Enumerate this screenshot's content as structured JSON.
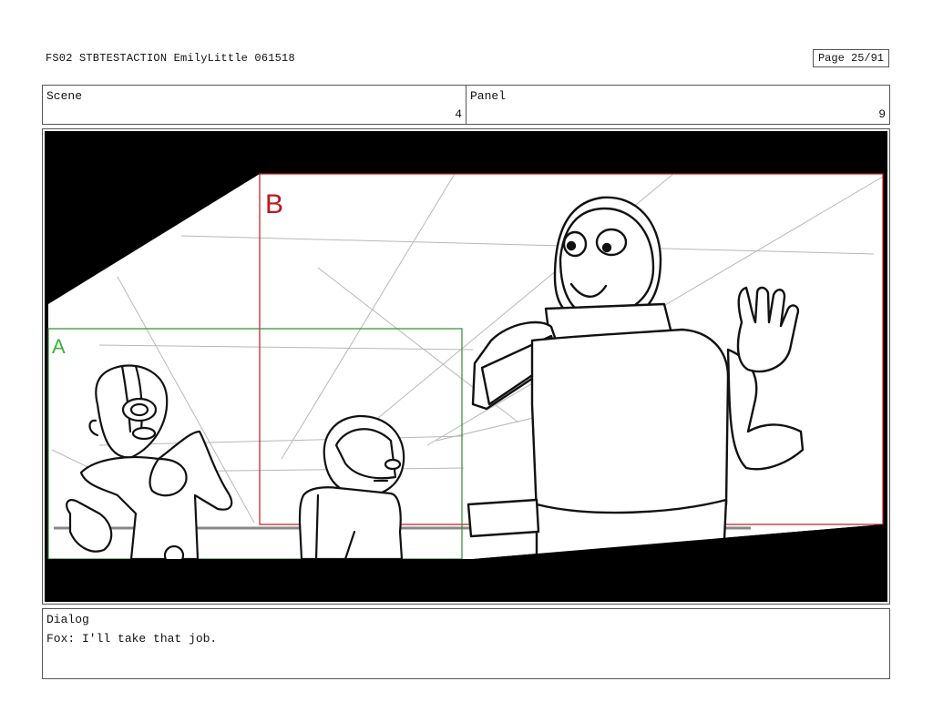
{
  "header": {
    "title": "FS02 STBTESTACTION EmilyLittle 061518",
    "page": "Page 25/91"
  },
  "scene": {
    "label": "Scene",
    "value": "4"
  },
  "panel": {
    "label": "Panel",
    "value": "9"
  },
  "artwork": {
    "frame_a_label": "A",
    "frame_b_label": "B",
    "frame_a_color": "#2e8b2e",
    "frame_b_color": "#c0181c"
  },
  "dialog": {
    "label": "Dialog",
    "text": "Fox: I'll take that job."
  }
}
